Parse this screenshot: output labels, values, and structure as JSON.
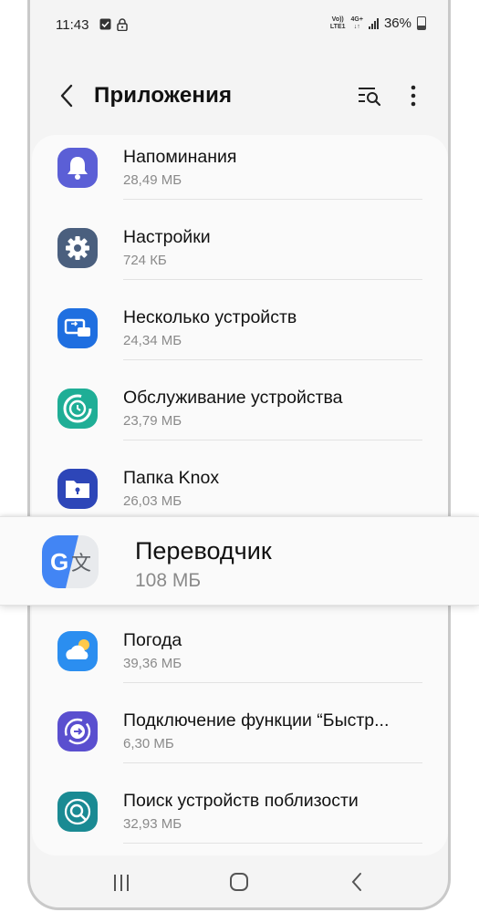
{
  "status_bar": {
    "time": "11:43",
    "network_top": "Vo))",
    "network_bottom": "LTE1",
    "network_type": "4G+",
    "battery": "36%"
  },
  "app_bar": {
    "title": "Приложения"
  },
  "apps": [
    {
      "name": "Напоминания",
      "size": "28,49 МБ",
      "icon": "bell-icon",
      "color": "#5b5fd6"
    },
    {
      "name": "Настройки",
      "size": "724 КБ",
      "icon": "gear-icon",
      "color": "#4a5f7e"
    },
    {
      "name": "Несколько устройств",
      "size": "24,34 МБ",
      "icon": "multi-device-icon",
      "color": "#1f6fe0"
    },
    {
      "name": "Обслуживание устройства",
      "size": "23,79 МБ",
      "icon": "device-care-icon",
      "color": "#1fae96"
    },
    {
      "name": "Папка Knox",
      "size": "26,03 МБ",
      "icon": "secure-folder-icon",
      "color": "#2d46b8"
    },
    {
      "name": "Переводчик",
      "size": "108 МБ",
      "icon": "google-translate-icon",
      "color": "#4285f4"
    },
    {
      "name": "Погода",
      "size": "39,36 МБ",
      "icon": "weather-icon",
      "color": "#2b8ef0"
    },
    {
      "name": "Подключение функции “Быстр...",
      "size": "6,30 МБ",
      "icon": "quick-share-icon",
      "color": "#5a4fcf"
    },
    {
      "name": "Поиск устройств поблизости",
      "size": "32,93 МБ",
      "icon": "nearby-scan-icon",
      "color": "#1a8a93"
    }
  ]
}
